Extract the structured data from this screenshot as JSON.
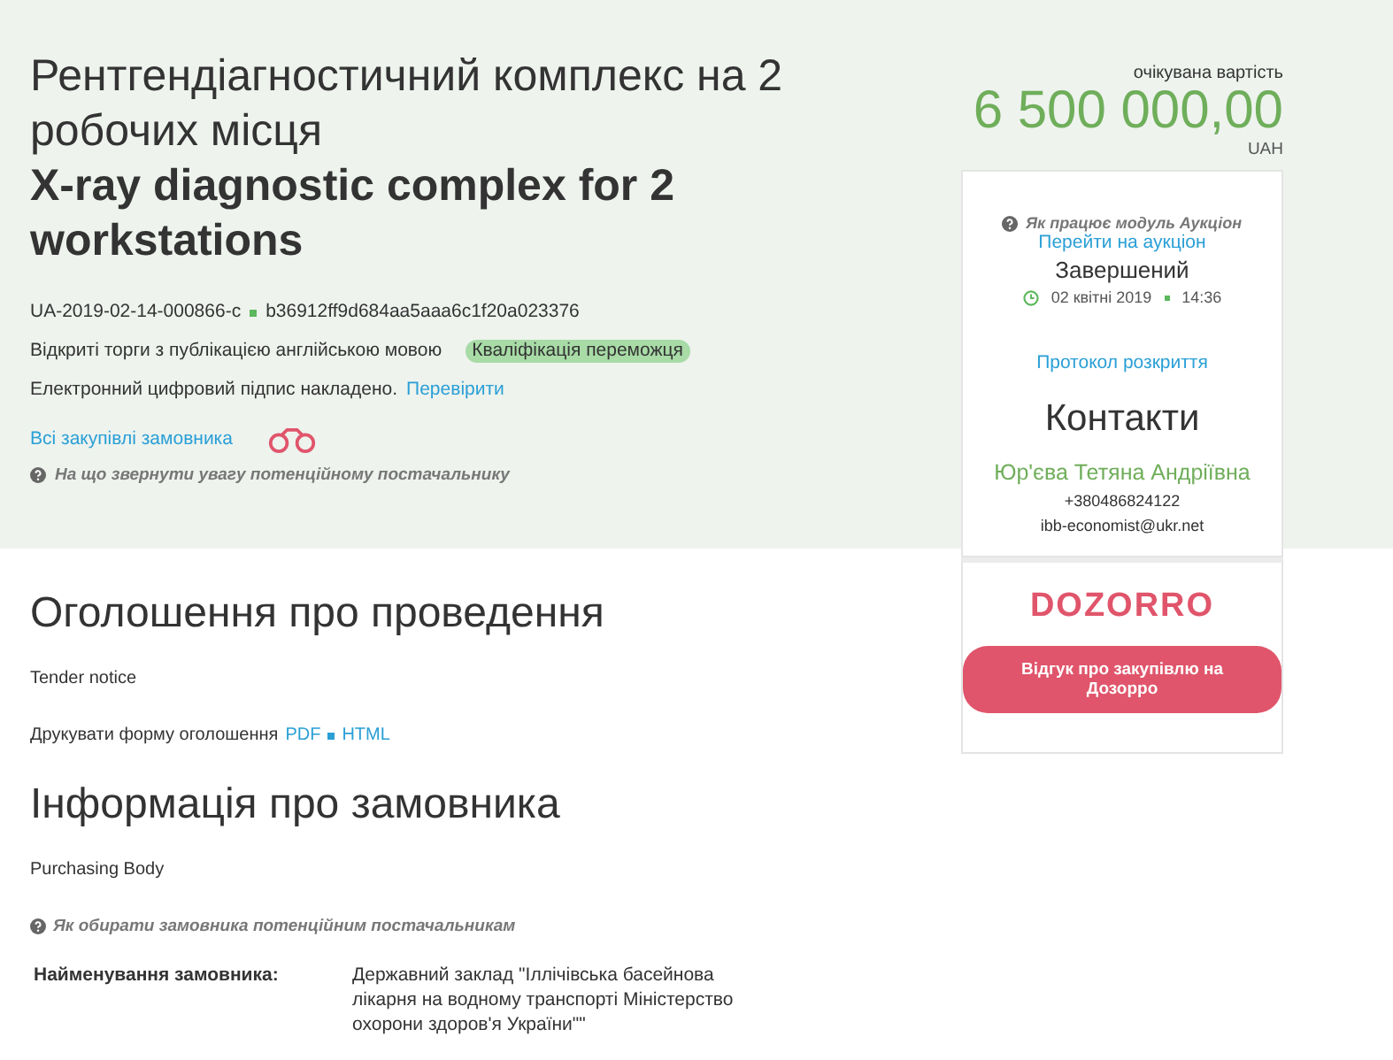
{
  "header": {
    "title_uk": "Рентгендіагностичний комплекс на 2 робочих місця",
    "title_en": "X-ray diagnostic complex for 2 workstations",
    "tender_id": "UA-2019-02-14-000866-c",
    "hash": "b36912ff9d684aa5aaa6c1f20a023376",
    "procedure": "Відкриті торги з публікацією англійською мовою",
    "status_badge": "Кваліфікація переможця",
    "signature_text": "Електронний цифровий підпис накладено.",
    "signature_link": "Перевірити",
    "buyer_link": "Всі закупівлі замовника",
    "hint": "На що звернути увагу потенційному постачальнику"
  },
  "price": {
    "label": "очікувана вартість",
    "amount": "6 500 000,00",
    "currency": "UAH"
  },
  "card": {
    "auction_hint": "Як працює модуль Аукціон",
    "auction_link": "Перейти на аукціон",
    "auction_status": "Завершений",
    "auction_date": "02 квітні 2019",
    "auction_time": "14:36",
    "protocol_link": "Протокол розкриття",
    "contacts_title": "Контакти",
    "contact_name": "Юр'єва Тетяна Андріївна",
    "phone": "+380486824122",
    "email": "ibb-economist@ukr.net"
  },
  "dozorro": {
    "logo": "DOZORRO",
    "button": "Відгук про закупівлю на Дозорро"
  },
  "sections": [
    {
      "title": "Оголошення про проведення",
      "subtitle": "Tender notice",
      "print_label": "Друкувати форму оголошення",
      "links": [
        "PDF",
        "HTML"
      ]
    },
    {
      "title": "Інформація про замовника",
      "subtitle": "Purchasing Body",
      "hint": "Як обирати замовника потенційним постачальникам",
      "fields": [
        {
          "label": "Найменування замовника:",
          "value": "Державний заклад \"Іллічівська басейнова лікарня на водному транспорті Міністерство охорони здоров'я України\"\""
        }
      ]
    }
  ]
}
